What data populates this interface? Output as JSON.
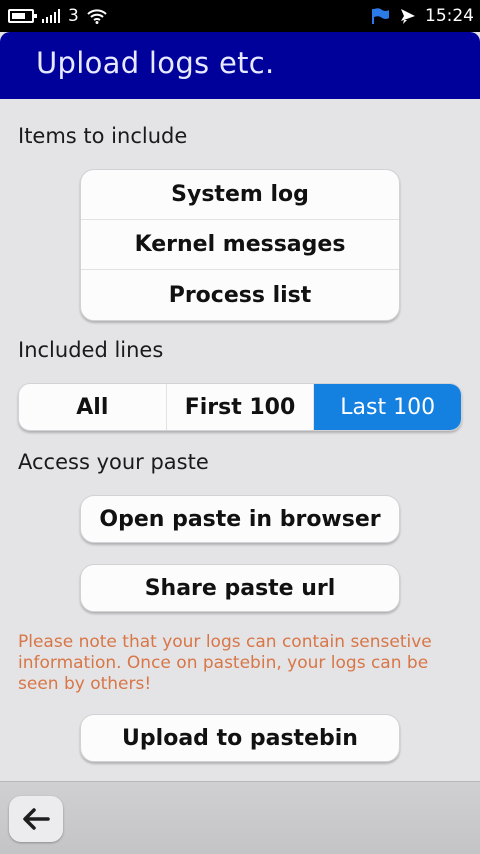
{
  "status_bar": {
    "carrier": "3",
    "time": "15:24"
  },
  "header": {
    "title": "Upload logs etc."
  },
  "items_section": {
    "label": "Items to include",
    "items": [
      "System log",
      "Kernel messages",
      "Process list"
    ]
  },
  "lines_section": {
    "label": "Included lines",
    "options": [
      "All",
      "First 100",
      "Last 100"
    ],
    "selected": "Last 100"
  },
  "access_section": {
    "label": "Access your paste",
    "open_label": "Open paste in browser",
    "share_label": "Share paste url"
  },
  "note": "Please note that your logs can contain sensetive information. Once on pastebin, your logs can be seen by others!",
  "upload_label": "Upload to pastebin",
  "colors": {
    "title_bar": "#00009b",
    "selected": "#1481e0",
    "warning": "#d87647"
  },
  "icons": [
    "battery-icon",
    "signal-icon",
    "wifi-icon",
    "notification-flag-icon",
    "chat-bubble-icon",
    "back-arrow-icon"
  ]
}
